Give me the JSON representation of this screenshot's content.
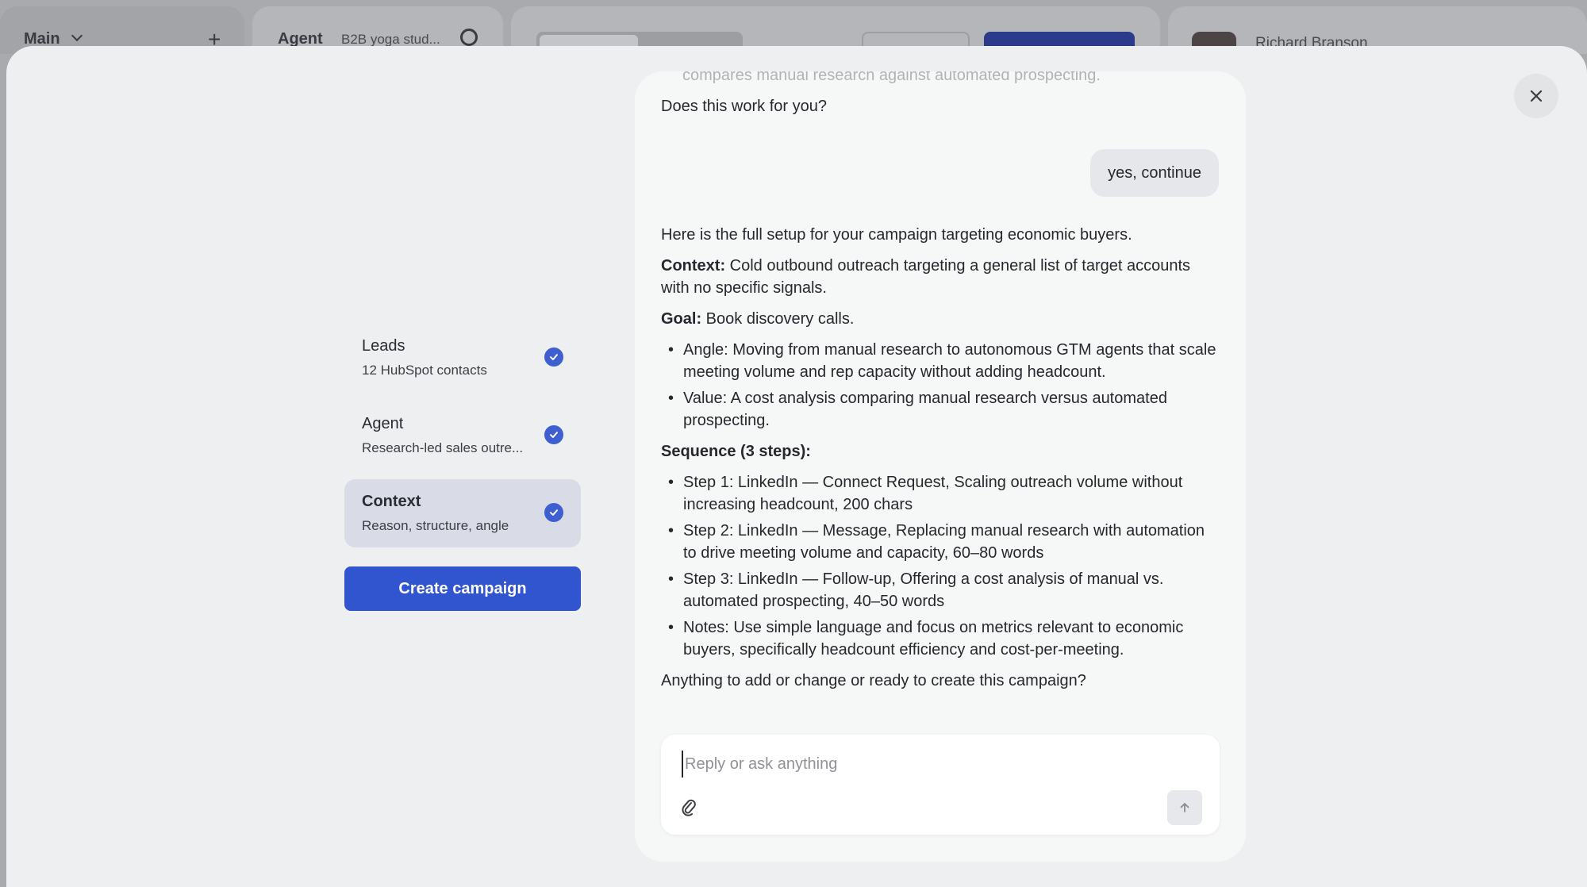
{
  "background_app": {
    "workspace_label": "Main",
    "agent_label": "Agent",
    "agent_subtitle": "B2B yoga stud...",
    "user_name": "Richard Branson"
  },
  "steps": [
    {
      "title": "Leads",
      "subtitle": "12 HubSpot contacts",
      "done": true,
      "active": false
    },
    {
      "title": "Agent",
      "subtitle": "Research-led sales outre...",
      "done": true,
      "active": false
    },
    {
      "title": "Context",
      "subtitle": "Reason, structure, angle",
      "done": true,
      "active": true
    }
  ],
  "create_button_label": "Create campaign",
  "chat": {
    "faded_previous_line": "compares manual research against automated prospecting.",
    "assistant_question": "Does this work for you?",
    "user_message": "yes, continue",
    "reply": {
      "intro": "Here is the full setup for your campaign targeting economic buyers.",
      "context_label": "Context:",
      "context_text": " Cold outbound outreach targeting a general list of target accounts with no specific signals.",
      "goal_label": "Goal:",
      "goal_text": " Book discovery calls.",
      "goal_bullets": [
        "Angle: Moving from manual research to autonomous GTM agents that scale meeting volume and rep capacity without adding headcount.",
        "Value: A cost analysis comparing manual research versus automated prospecting."
      ],
      "sequence_label": "Sequence (3 steps):",
      "sequence_bullets": [
        "Step 1: LinkedIn — Connect Request, Scaling outreach volume without increasing headcount, 200 chars",
        "Step 2: LinkedIn — Message, Replacing manual research with automation to drive meeting volume and capacity, 60–80 words",
        "Step 3: LinkedIn — Follow-up, Offering a cost analysis of manual vs. automated prospecting, 40–50 words",
        "Notes: Use simple language and focus on metrics relevant to economic buyers, specifically headcount efficiency and cost-per-meeting."
      ],
      "closing": "Anything to add or change or ready to create this campaign?"
    },
    "composer": {
      "placeholder": "Reply or ask anything",
      "value": ""
    }
  },
  "colors": {
    "primary": "#3055cf",
    "check": "#3d5fd0",
    "active_step_bg": "#d9dbe6"
  }
}
